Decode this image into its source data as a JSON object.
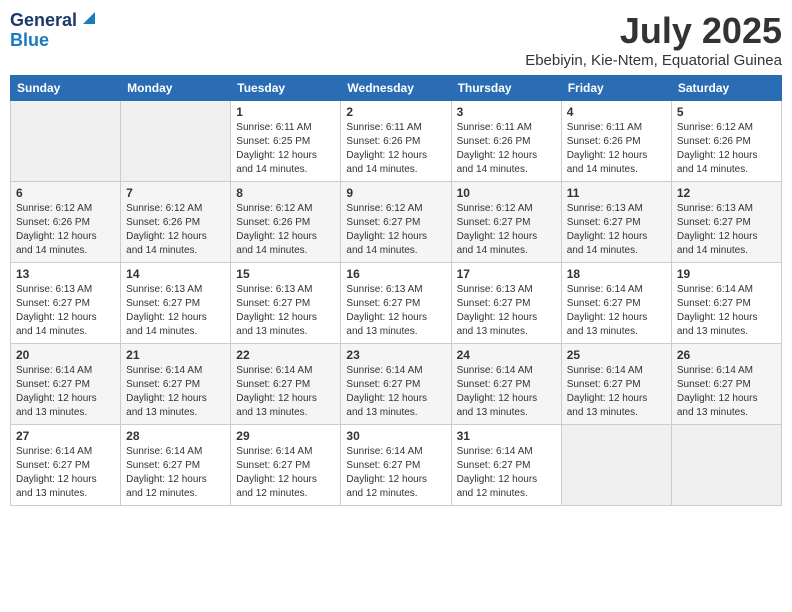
{
  "logo": {
    "line1": "General",
    "line2": "Blue"
  },
  "header": {
    "month_year": "July 2025",
    "location": "Ebebiyin, Kie-Ntem, Equatorial Guinea"
  },
  "weekdays": [
    "Sunday",
    "Monday",
    "Tuesday",
    "Wednesday",
    "Thursday",
    "Friday",
    "Saturday"
  ],
  "weeks": [
    [
      {
        "day": "",
        "text": "",
        "empty": true
      },
      {
        "day": "",
        "text": "",
        "empty": true
      },
      {
        "day": "1",
        "text": "Sunrise: 6:11 AM\nSunset: 6:25 PM\nDaylight: 12 hours and 14 minutes."
      },
      {
        "day": "2",
        "text": "Sunrise: 6:11 AM\nSunset: 6:26 PM\nDaylight: 12 hours and 14 minutes."
      },
      {
        "day": "3",
        "text": "Sunrise: 6:11 AM\nSunset: 6:26 PM\nDaylight: 12 hours and 14 minutes."
      },
      {
        "day": "4",
        "text": "Sunrise: 6:11 AM\nSunset: 6:26 PM\nDaylight: 12 hours and 14 minutes."
      },
      {
        "day": "5",
        "text": "Sunrise: 6:12 AM\nSunset: 6:26 PM\nDaylight: 12 hours and 14 minutes."
      }
    ],
    [
      {
        "day": "6",
        "text": "Sunrise: 6:12 AM\nSunset: 6:26 PM\nDaylight: 12 hours and 14 minutes."
      },
      {
        "day": "7",
        "text": "Sunrise: 6:12 AM\nSunset: 6:26 PM\nDaylight: 12 hours and 14 minutes."
      },
      {
        "day": "8",
        "text": "Sunrise: 6:12 AM\nSunset: 6:26 PM\nDaylight: 12 hours and 14 minutes."
      },
      {
        "day": "9",
        "text": "Sunrise: 6:12 AM\nSunset: 6:27 PM\nDaylight: 12 hours and 14 minutes."
      },
      {
        "day": "10",
        "text": "Sunrise: 6:12 AM\nSunset: 6:27 PM\nDaylight: 12 hours and 14 minutes."
      },
      {
        "day": "11",
        "text": "Sunrise: 6:13 AM\nSunset: 6:27 PM\nDaylight: 12 hours and 14 minutes."
      },
      {
        "day": "12",
        "text": "Sunrise: 6:13 AM\nSunset: 6:27 PM\nDaylight: 12 hours and 14 minutes."
      }
    ],
    [
      {
        "day": "13",
        "text": "Sunrise: 6:13 AM\nSunset: 6:27 PM\nDaylight: 12 hours and 14 minutes."
      },
      {
        "day": "14",
        "text": "Sunrise: 6:13 AM\nSunset: 6:27 PM\nDaylight: 12 hours and 14 minutes."
      },
      {
        "day": "15",
        "text": "Sunrise: 6:13 AM\nSunset: 6:27 PM\nDaylight: 12 hours and 13 minutes."
      },
      {
        "day": "16",
        "text": "Sunrise: 6:13 AM\nSunset: 6:27 PM\nDaylight: 12 hours and 13 minutes."
      },
      {
        "day": "17",
        "text": "Sunrise: 6:13 AM\nSunset: 6:27 PM\nDaylight: 12 hours and 13 minutes."
      },
      {
        "day": "18",
        "text": "Sunrise: 6:14 AM\nSunset: 6:27 PM\nDaylight: 12 hours and 13 minutes."
      },
      {
        "day": "19",
        "text": "Sunrise: 6:14 AM\nSunset: 6:27 PM\nDaylight: 12 hours and 13 minutes."
      }
    ],
    [
      {
        "day": "20",
        "text": "Sunrise: 6:14 AM\nSunset: 6:27 PM\nDaylight: 12 hours and 13 minutes."
      },
      {
        "day": "21",
        "text": "Sunrise: 6:14 AM\nSunset: 6:27 PM\nDaylight: 12 hours and 13 minutes."
      },
      {
        "day": "22",
        "text": "Sunrise: 6:14 AM\nSunset: 6:27 PM\nDaylight: 12 hours and 13 minutes."
      },
      {
        "day": "23",
        "text": "Sunrise: 6:14 AM\nSunset: 6:27 PM\nDaylight: 12 hours and 13 minutes."
      },
      {
        "day": "24",
        "text": "Sunrise: 6:14 AM\nSunset: 6:27 PM\nDaylight: 12 hours and 13 minutes."
      },
      {
        "day": "25",
        "text": "Sunrise: 6:14 AM\nSunset: 6:27 PM\nDaylight: 12 hours and 13 minutes."
      },
      {
        "day": "26",
        "text": "Sunrise: 6:14 AM\nSunset: 6:27 PM\nDaylight: 12 hours and 13 minutes."
      }
    ],
    [
      {
        "day": "27",
        "text": "Sunrise: 6:14 AM\nSunset: 6:27 PM\nDaylight: 12 hours and 13 minutes."
      },
      {
        "day": "28",
        "text": "Sunrise: 6:14 AM\nSunset: 6:27 PM\nDaylight: 12 hours and 12 minutes."
      },
      {
        "day": "29",
        "text": "Sunrise: 6:14 AM\nSunset: 6:27 PM\nDaylight: 12 hours and 12 minutes."
      },
      {
        "day": "30",
        "text": "Sunrise: 6:14 AM\nSunset: 6:27 PM\nDaylight: 12 hours and 12 minutes."
      },
      {
        "day": "31",
        "text": "Sunrise: 6:14 AM\nSunset: 6:27 PM\nDaylight: 12 hours and 12 minutes."
      },
      {
        "day": "",
        "text": "",
        "empty": true
      },
      {
        "day": "",
        "text": "",
        "empty": true
      }
    ]
  ]
}
